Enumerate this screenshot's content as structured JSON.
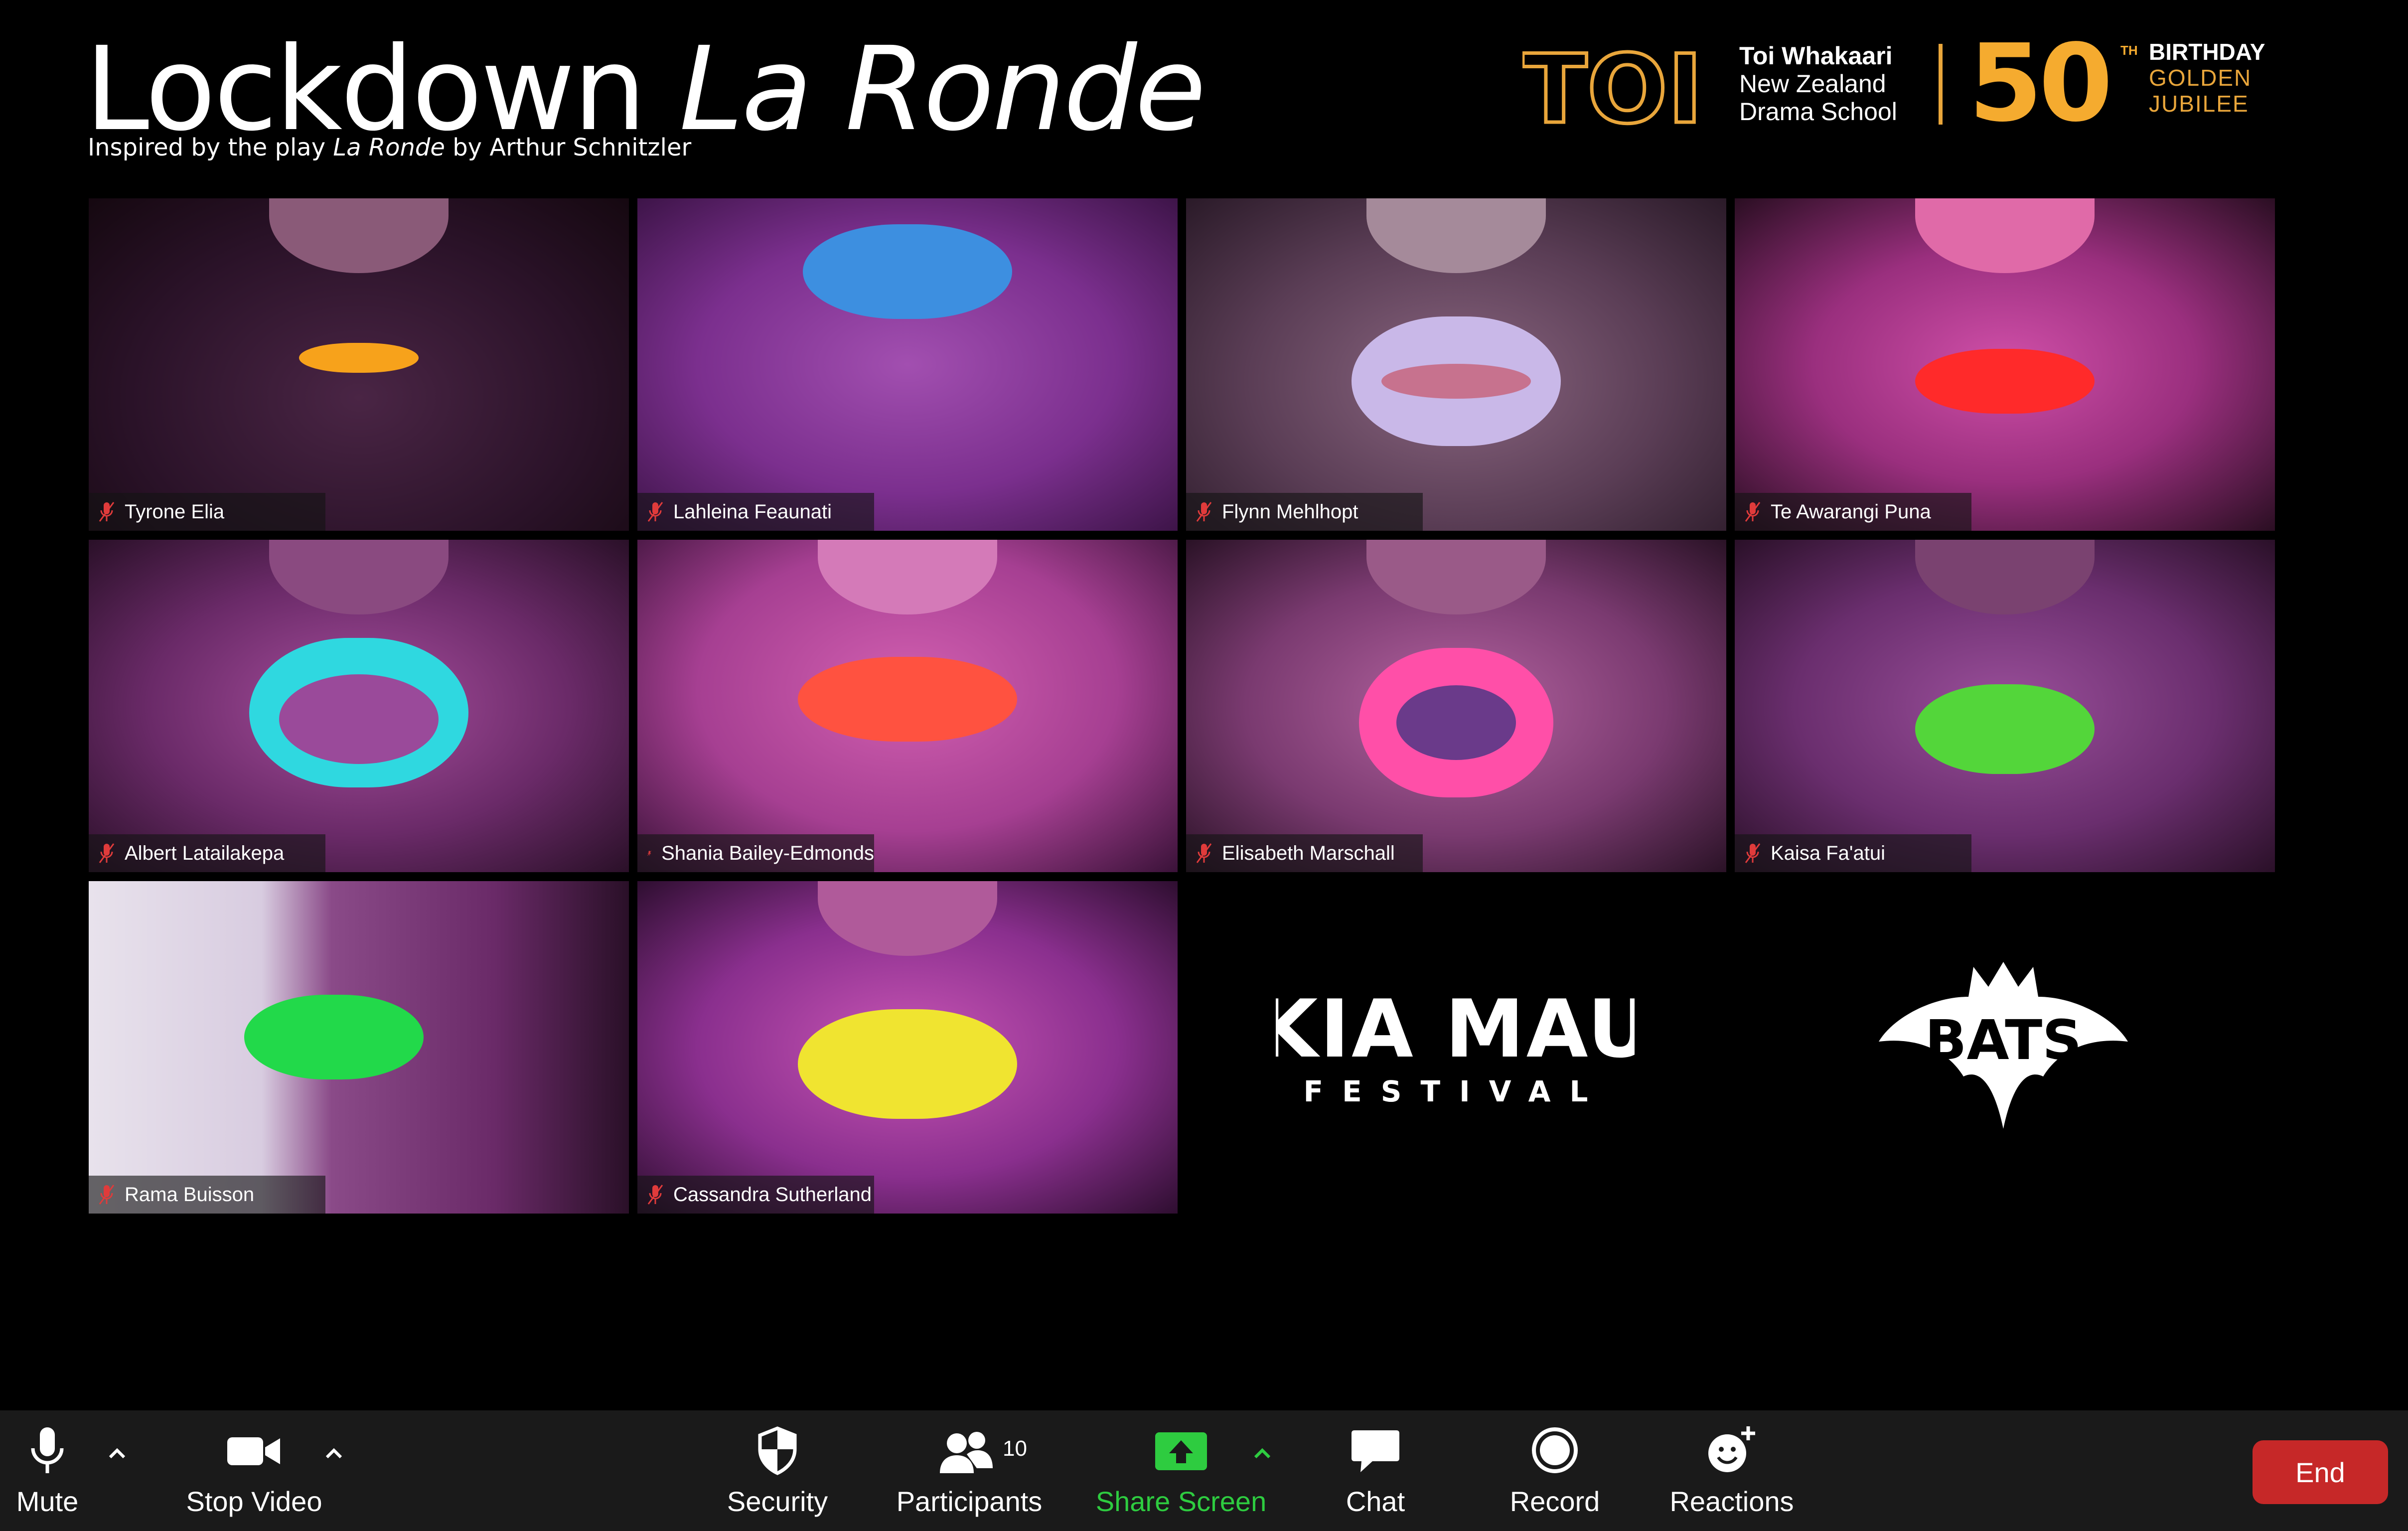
{
  "header": {
    "title_main": "Lockdown ",
    "title_italic": "La Ronde",
    "subtitle_prefix": "Inspired by the play ",
    "subtitle_italic": "La Ronde",
    "subtitle_suffix": " by Arthur Schnitzler"
  },
  "branding": {
    "toi_logo": "TOI",
    "toi_line1": "Toi Whakaari",
    "toi_line2": "New Zealand",
    "toi_line3": "Drama School",
    "fifty": "50",
    "th": "TH",
    "birthday": "BIRTHDAY",
    "golden": "GOLDEN",
    "jubilee": "JUBILEE",
    "accent_color": "#e9a63b"
  },
  "participants": [
    {
      "name": "Tyrone Elia",
      "lip_color": "#f7a21b"
    },
    {
      "name": "Lahleina Feaunati",
      "lip_color": "#3d8fe0"
    },
    {
      "name": "Flynn Mehlhopt",
      "lip_color": "#c9b8e8"
    },
    {
      "name": "Te Awarangi Puna",
      "lip_color": "#ff2a2a"
    },
    {
      "name": "Albert Latailakepa",
      "lip_color": "#2fd8e0"
    },
    {
      "name": "Shania Bailey-Edmonds",
      "lip_color": "#ff5240"
    },
    {
      "name": "Elisabeth Marschall",
      "lip_color": "#ff4fa8"
    },
    {
      "name": "Kaisa Fa'atui",
      "lip_color": "#53d63a"
    },
    {
      "name": "Rama Buisson",
      "lip_color": "#22d94a"
    },
    {
      "name": "Cassandra Sutherland",
      "lip_color": "#f0e430"
    }
  ],
  "sponsors": {
    "kia_mau": "KIA MAU",
    "festival": "FESTIVAL",
    "bats": "BATS"
  },
  "toolbar": {
    "mute": "Mute",
    "stop_video": "Stop Video",
    "security": "Security",
    "participants": "Participants",
    "participant_count": "10",
    "share_screen": "Share Screen",
    "chat": "Chat",
    "record": "Record",
    "reactions": "Reactions",
    "end": "End",
    "share_color": "#2ecc40",
    "end_color": "#c62828"
  }
}
